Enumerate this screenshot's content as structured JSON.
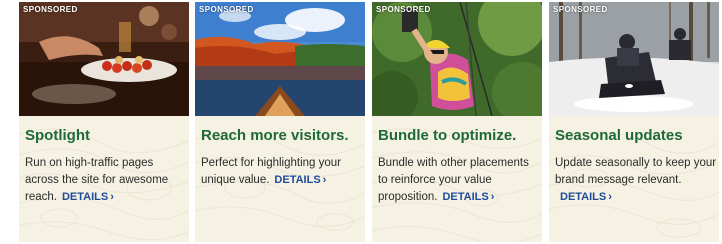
{
  "cards": [
    {
      "badge": "SPONSORED",
      "title": "Spotlight",
      "body": "Run on high-traffic pages across the site for awesome reach.",
      "details_label": "DETAILS",
      "image": "food-dish-photo"
    },
    {
      "badge": "SPONSORED",
      "title": "Reach more visitors.",
      "body": "Perfect for highlighting your unique value.",
      "details_label": "DETAILS",
      "image": "canoe-lake-photo"
    },
    {
      "badge": "SPONSORED",
      "title": "Bundle to optimize.",
      "body": "Bundle with other placements to reinforce your value proposition.",
      "details_label": "DETAILS",
      "image": "zipline-photo"
    },
    {
      "badge": "SPONSORED",
      "title": "Seasonal updates",
      "body": "Update seasonally to keep your brand message relevant.",
      "details_label": "DETAILS",
      "image": "snowmobile-photo"
    }
  ],
  "colors": {
    "card_bg": "#f5f1e3",
    "title_green": "#1e6a37",
    "link_blue": "#1f4b9b",
    "body_text": "#2b2b2b"
  },
  "icons": {
    "details_chevron": "chevron-right-icon"
  }
}
